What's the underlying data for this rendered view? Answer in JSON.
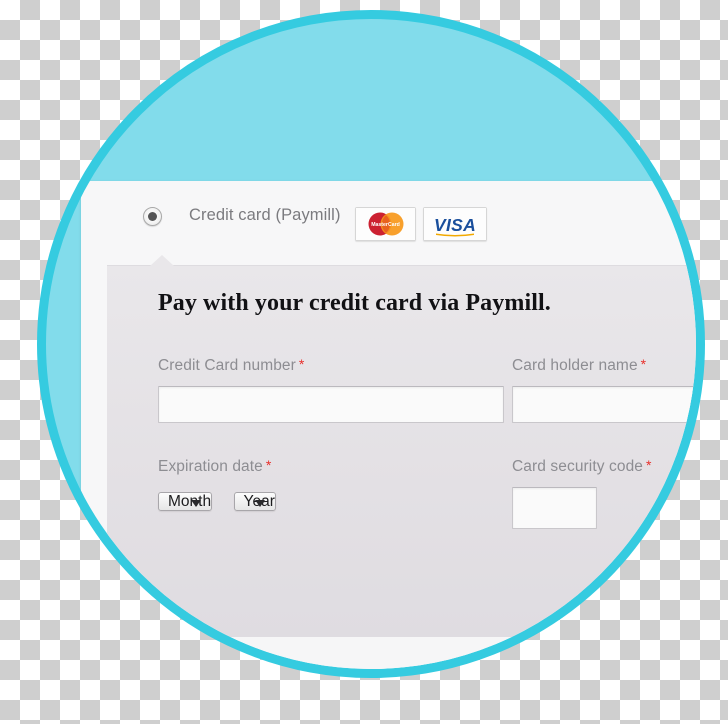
{
  "payment_method": {
    "radio_name": "credit-card-paymill",
    "selected": true,
    "label": "Credit card (Paymill)",
    "accepted_cards": [
      {
        "name": "mastercard",
        "text": "MasterCard"
      },
      {
        "name": "visa",
        "text": "VISA"
      }
    ]
  },
  "panel": {
    "heading": "Pay with your credit card via Paymill.",
    "fields": {
      "card_number": {
        "label": "Credit Card number",
        "required_marker": "*",
        "value": "",
        "placeholder": ""
      },
      "holder_name": {
        "label": "Card holder name",
        "required_marker": "*",
        "value": "",
        "placeholder": ""
      },
      "expiration": {
        "label": "Expiration date",
        "required_marker": "*",
        "month_selected": "Month",
        "year_selected": "Year"
      },
      "security_code": {
        "label": "Card security code",
        "required_marker": "*",
        "value": "",
        "placeholder": ""
      }
    }
  },
  "colors": {
    "circle_fill": "#82dceb",
    "circle_border": "#35cbe0",
    "panel_bg": "#e6e3e8",
    "required_red": "#e8302c",
    "label_gray": "#8d8d92",
    "mastercard_red": "#cc2131",
    "mastercard_orange": "#f7991c",
    "visa_blue": "#1a4f9c",
    "visa_gold": "#f2a900"
  }
}
